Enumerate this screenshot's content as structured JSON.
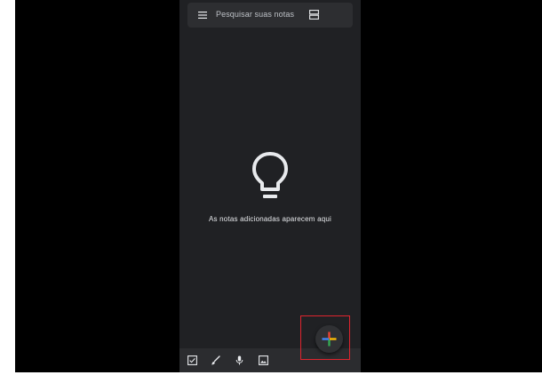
{
  "search": {
    "placeholder_text": "Pesquisar suas notas"
  },
  "empty_state": {
    "icon": "lightbulb-icon",
    "message": "As notas adicionadas aparecem aqui"
  },
  "toolbar": {
    "icons": [
      "checkbox-icon",
      "brush-icon",
      "microphone-icon",
      "image-icon"
    ]
  },
  "fab": {
    "icon": "plus-icon",
    "colors": [
      "#4285f4",
      "#ea4335",
      "#fbbc05",
      "#34a853"
    ]
  },
  "colors": {
    "background": "#202124",
    "surface": "#2d2e31",
    "text": "#e8eaed",
    "highlight": "#e0242e"
  }
}
